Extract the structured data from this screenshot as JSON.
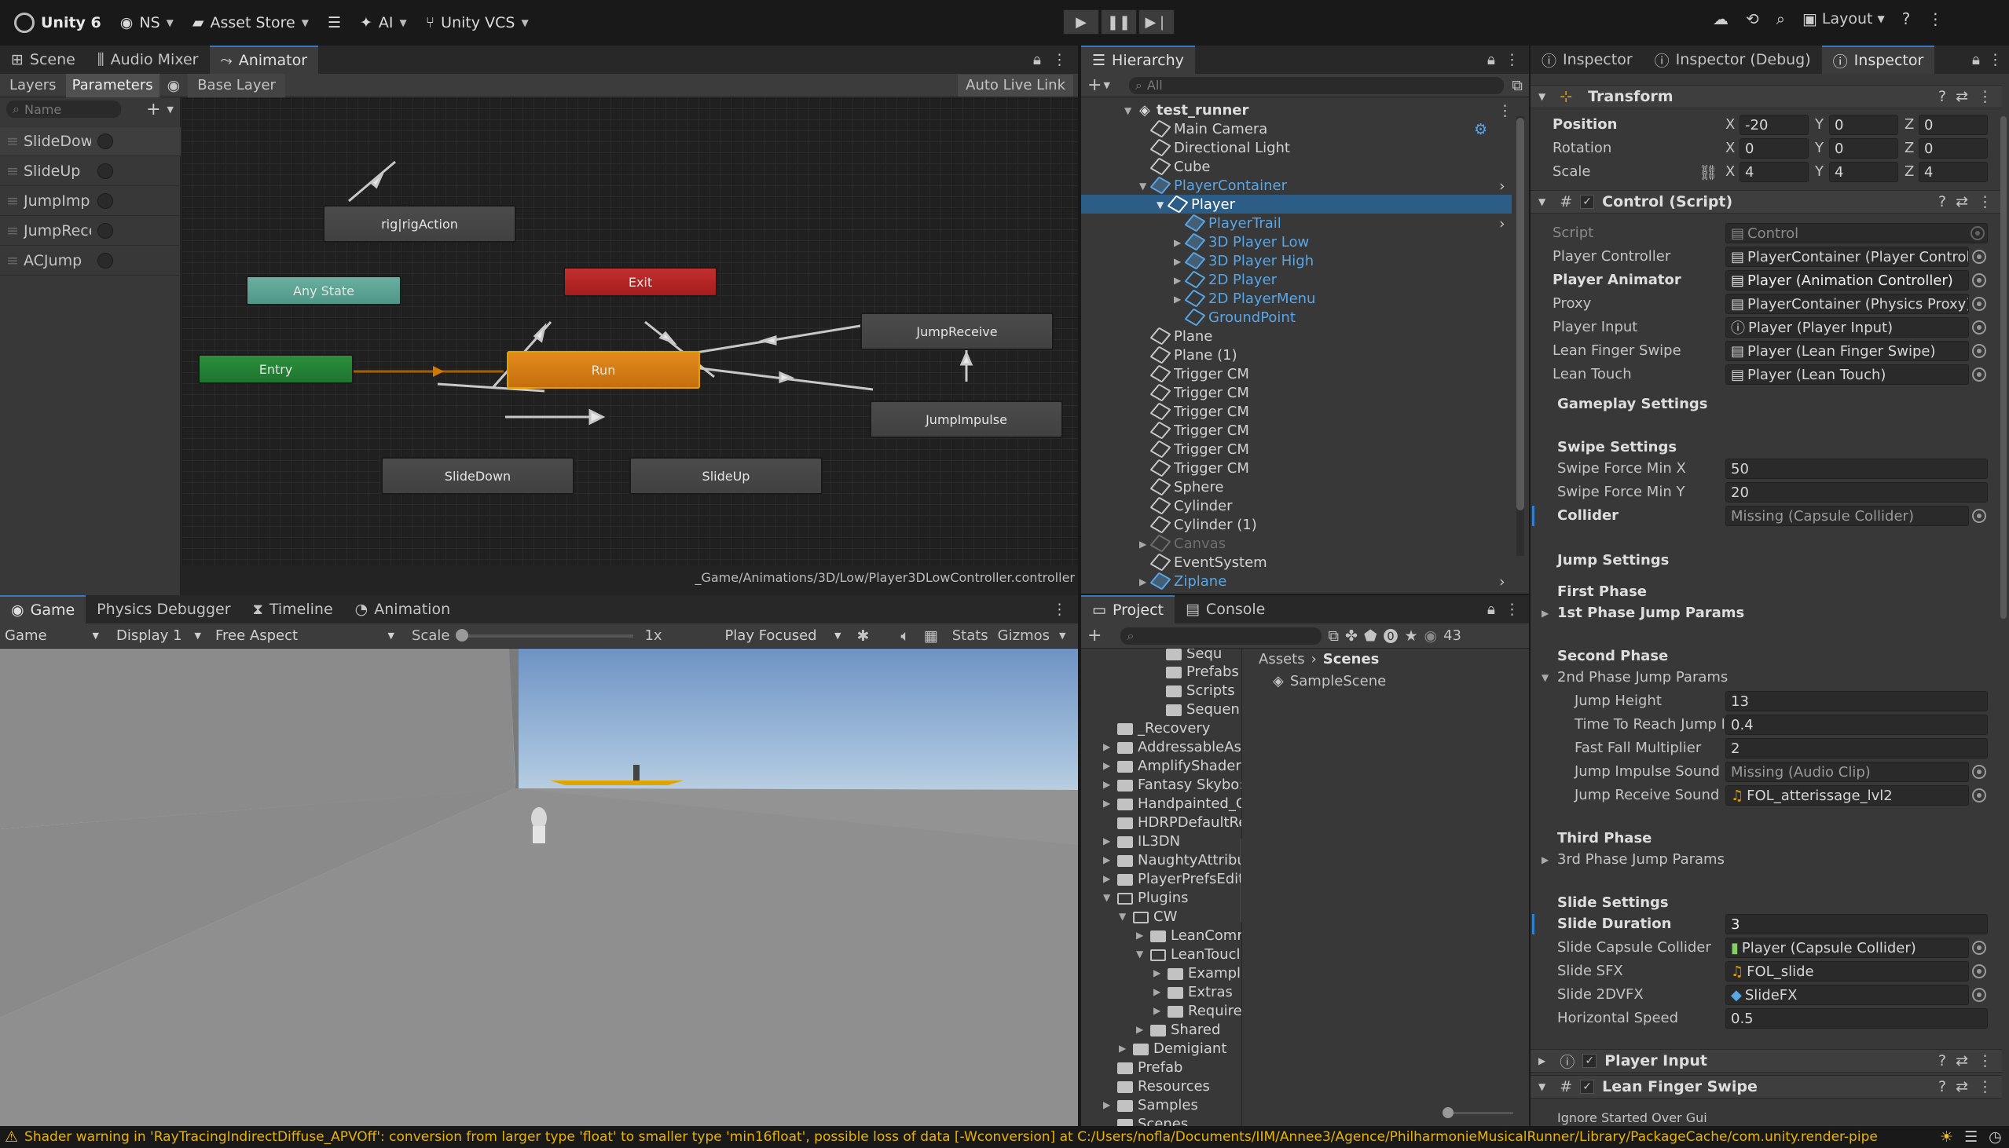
{
  "topbar": {
    "title": "Unity 6",
    "account": "NS",
    "asset_store": "Asset Store",
    "ai": "AI",
    "vcs": "Unity VCS",
    "layout": "Layout"
  },
  "animator": {
    "tabs": [
      "Scene",
      "Audio Mixer",
      "Animator"
    ],
    "subtabs": {
      "layers": "Layers",
      "parameters": "Parameters",
      "breadcrumb": "Base Layer",
      "auto_live_link": "Auto Live Link"
    },
    "search_placeholder": "Name",
    "params": [
      "SlideDown",
      "SlideUp",
      "JumpImpulse",
      "JumpReceive",
      "ACJump"
    ],
    "nodes": {
      "rig": "rig|rigAction",
      "any_state": "Any State",
      "exit": "Exit",
      "entry": "Entry",
      "run": "Run",
      "jump_receive": "JumpReceive",
      "jump_impulse": "JumpImpulse",
      "slide_down": "SlideDown",
      "slide_up": "SlideUp"
    },
    "path": "_Game/Animations/3D/Low/Player3DLowController.controller"
  },
  "hierarchy": {
    "tab": "Hierarchy",
    "search_placeholder": "All",
    "scene": "test_runner",
    "items": [
      "Main Camera",
      "Directional Light",
      "Cube",
      "PlayerContainer",
      "Player",
      "PlayerTrail",
      "3D Player Low",
      "3D Player High",
      "2D Player",
      "2D PlayerMenu",
      "GroundPoint",
      "Plane",
      "Plane (1)",
      "Trigger CM",
      "Trigger CM",
      "Trigger CM",
      "Trigger CM",
      "Trigger CM",
      "Trigger CM",
      "Sphere",
      "Cylinder",
      "Cylinder (1)",
      "Canvas",
      "EventSystem",
      "Ziplane"
    ]
  },
  "game": {
    "tabs": [
      "Game",
      "Physics Debugger",
      "Timeline",
      "Animation"
    ],
    "game_dd": "Game",
    "display_dd": "Display 1",
    "aspect_dd": "Free Aspect",
    "scale_label": "Scale",
    "scale_value": "1x",
    "play_focused": "Play Focused",
    "stats": "Stats",
    "gizmos": "Gizmos"
  },
  "project": {
    "tabs": [
      "Project",
      "Console"
    ],
    "hidden_count": "43",
    "breadcrumb": [
      "Assets",
      "Scenes"
    ],
    "asset": "SampleScene",
    "tree": [
      "Sequ",
      "Prefabs",
      "Scripts",
      "Sequen",
      "_Recovery",
      "AddressableAs",
      "AmplifyShaderE",
      "Fantasy Skybo:",
      "Handpainted_G",
      "HDRPDefaultRe",
      "IL3DN",
      "NaughtyAttribu",
      "PlayerPrefsEdit",
      "Plugins",
      "CW",
      "LeanComr",
      "LeanToucl",
      "Example",
      "Extras",
      "Require",
      "Shared",
      "Demigiant",
      "Prefab",
      "Resources",
      "Samples",
      "Scenes"
    ]
  },
  "inspector": {
    "tabs": [
      "Inspector",
      "Inspector (Debug)",
      "Inspector"
    ],
    "transform": {
      "title": "Transform",
      "position_label": "Position",
      "rotation_label": "Rotation",
      "scale_label": "Scale",
      "position": [
        "-20",
        "0",
        "0"
      ],
      "rotation": [
        "0",
        "0",
        "0"
      ],
      "scale": [
        "4",
        "4",
        "4"
      ]
    },
    "control": {
      "title": "Control (Script)",
      "fields": [
        {
          "label": "Script",
          "value": "Control"
        },
        {
          "label": "Player Controller",
          "value": "PlayerContainer (Player Controller"
        },
        {
          "label": "Player Animator",
          "value": "Player (Animation Controller)"
        },
        {
          "label": "Proxy",
          "value": "PlayerContainer (Physics Proxy)"
        },
        {
          "label": "Player Input",
          "value": "Player (Player Input)"
        },
        {
          "label": "Lean Finger Swipe",
          "value": "Player (Lean Finger Swipe)"
        },
        {
          "label": "Lean Touch",
          "value": "Player (Lean Touch)"
        }
      ],
      "gameplay_settings": "Gameplay Settings",
      "swipe_settings": "Swipe Settings",
      "swipe_x_label": "Swipe Force Min X",
      "swipe_x": "50",
      "swipe_y_label": "Swipe Force Min Y",
      "swipe_y": "20",
      "collider_label": "Collider",
      "collider": "Missing (Capsule Collider)",
      "jump_settings": "Jump Settings",
      "first_phase": "First Phase",
      "first_params": "1st Phase Jump Params",
      "second_phase": "Second Phase",
      "second_params": "2nd Phase Jump Params",
      "jump_height_label": "Jump Height",
      "jump_height": "13",
      "time_reach_label": "Time To Reach Jump H",
      "time_reach": "0.4",
      "fast_fall_label": "Fast Fall Multiplier",
      "fast_fall": "2",
      "impulse_sound_label": "Jump Impulse Sound",
      "impulse_sound": "Missing (Audio Clip)",
      "receive_sound_label": "Jump Receive Sound",
      "receive_sound": "FOL_atterissage_lvl2",
      "third_phase": "Third Phase",
      "third_params": "3rd Phase Jump Params",
      "slide_settings": "Slide Settings",
      "slide_duration_label": "Slide Duration",
      "slide_duration": "3",
      "slide_collider_label": "Slide Capsule Collider",
      "slide_collider": "Player (Capsule Collider)",
      "slide_sfx_label": "Slide SFX",
      "slide_sfx": "FOL_slide",
      "slide_vfx_label": "Slide 2DVFX",
      "slide_vfx": "SlideFX",
      "horiz_speed_label": "Horizontal Speed",
      "horiz_speed": "0.5"
    },
    "player_input": "Player Input",
    "lean_swipe": "Lean Finger Swipe",
    "ignore_label": "Ignore Started Over Gui"
  },
  "status": {
    "text": "Shader warning in 'RayTracingIndirectDiffuse_APVOff': conversion from larger type 'float' to smaller type 'min16float', possible loss of data [-Wconversion] at C:/Users/nofla/Documents/IIM/Annee3/Agence/PhilharmonieMusicalRunner/Library/PackageCache/com.unity.render-pipe"
  }
}
